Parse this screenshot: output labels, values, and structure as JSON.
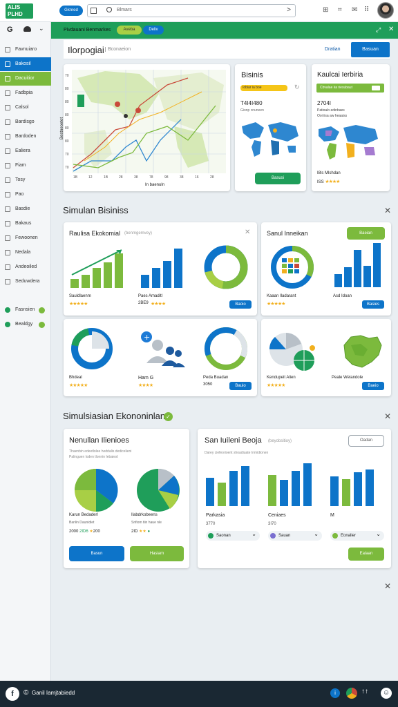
{
  "app": {
    "logo_text": "ALIS PLHD"
  },
  "topbar": {
    "btn_label": "Gknred",
    "search_placeholder": "Blmars"
  },
  "banner": {
    "title": "Pivdauani Benmarkes",
    "pill_green": "Aveba",
    "pill_blue": "Deliv"
  },
  "header": {
    "title": "Ilorpogiai",
    "subtitle": "Bconaeion",
    "link": "Dratian",
    "button": "Basuan"
  },
  "sidebar": {
    "top_icons": [
      "G",
      "cloud-icon"
    ],
    "items": [
      {
        "label": "Favnuiaro",
        "icon": "doc-icon"
      },
      {
        "label": "Bakosil",
        "icon": "doc-icon",
        "active": "blue"
      },
      {
        "label": "Dacuitior",
        "icon": "doc-icon",
        "active": "green"
      },
      {
        "label": "Fadbpia",
        "icon": "doc-icon"
      },
      {
        "label": "Calsol",
        "icon": "doc-icon"
      },
      {
        "label": "Bardisgo",
        "icon": "doc-icon"
      },
      {
        "label": "Bardoden",
        "icon": "doc-icon"
      },
      {
        "label": "Ealiera",
        "icon": "doc-icon"
      },
      {
        "label": "Fiam",
        "icon": "doc-icon"
      },
      {
        "label": "Tosy",
        "icon": "doc-icon"
      },
      {
        "label": "Pao",
        "icon": "doc-icon"
      },
      {
        "label": "Basdie",
        "icon": "doc-icon"
      },
      {
        "label": "Bakaus",
        "icon": "doc-icon"
      },
      {
        "label": "Fewoonen",
        "icon": "doc-icon"
      },
      {
        "label": "Nedala",
        "icon": "doc-icon"
      },
      {
        "label": "Andeoiled",
        "icon": "doc-icon"
      },
      {
        "label": "Seduwdera",
        "icon": "doc-icon"
      },
      {
        "label": "Fasnsien",
        "icon": "doc-icon"
      },
      {
        "label": "Bealdgy",
        "icon": "doc-icon"
      }
    ]
  },
  "dashboard": {
    "map_card": {
      "xlabel": "In baenuln",
      "ylabel": "Bestneoetot",
      "xticks": [
        "1B",
        "12",
        "1B",
        "28",
        "38",
        "78",
        "98",
        "38",
        "16",
        "28"
      ],
      "yticks": [
        "70",
        "80",
        "80",
        "80",
        "80",
        "80",
        "70",
        "70"
      ]
    },
    "card2": {
      "title": "Bisinis",
      "progress_label": "Iobiar ia boe",
      "value": "T4I4I480",
      "caption": "Gionp cnuneen",
      "button": "Basusi"
    },
    "card3": {
      "title": "Kaulcai Ierbiria",
      "progress_label": "Cbvalae ka riesubaut",
      "value": "2704I",
      "line1": "Patioalo edinbaes",
      "line2": "Ooi iisa aw heaaiss",
      "footer1": "I8ls Mlshdan",
      "footer2": "ISS"
    }
  },
  "section1": {
    "title": "Simulan Bisiniss",
    "card_a": {
      "title": "Raulisa Ekokomial",
      "subtitle": "(benmgemvey)",
      "chart_left": {
        "values": [
          14,
          20,
          30,
          38,
          52
        ]
      },
      "chart_mid": {
        "values": [
          18,
          28,
          38,
          55
        ]
      },
      "label1": "Sauldlaenm",
      "label2": "Paes Amaditl",
      "stars2": "2BE9",
      "button": "Baoio"
    },
    "card_b": {
      "title": "Sanul Inneikan",
      "button": "Baeian",
      "chart": {
        "values": [
          18,
          28,
          52,
          30,
          62
        ]
      },
      "label1": "Kaaan Iladarant",
      "label2": "Asd Idoan",
      "button2": "Basies"
    },
    "card_c": {
      "label1": "Bhdeal",
      "label2": "Ham G",
      "label3": "Peda Buadan",
      "stars3": "3050",
      "button": "Bauio"
    },
    "card_d": {
      "label1": "Kendupeit Alien",
      "label2": "Peale Welandole",
      "button": "Baeio"
    }
  },
  "section2": {
    "title": "Simulsiasian Ekononinlan",
    "card_a": {
      "title": "Nenullan Ilienioes",
      "desc1": "Thaenbin edeetlolee heddalis dedicelieni",
      "desc2": "Palinguen loden tlonnin Iebaiesl",
      "pie1": "Karun Bedaderl",
      "pie2": "Ilabdrkobeens",
      "sub1": "Banlin Daunidiet",
      "sub2": "Snfiom tiin haue nle",
      "val1": "2000",
      "val2": "2ID6",
      "val3": "200",
      "val4": "2ID",
      "btn_blue": "Basun",
      "btn_green": "Hasiam"
    },
    "card_b": {
      "title": "San Iuileni Beoja",
      "subtitle": "(beyobsitioy)",
      "desc": "Darey ciefeorioent shoadiuate Inmidionen",
      "button": "Oadan",
      "charts": [
        {
          "label": "Parkasia",
          "value": "3770",
          "chip": "Saonan",
          "values": [
            44,
            36,
            54,
            62
          ]
        },
        {
          "label": "Ceniaes",
          "value": "3I70",
          "chip": "Sauan",
          "values": [
            48,
            40,
            54,
            66
          ]
        },
        {
          "label": "M",
          "value": "",
          "chip": "Eonalier",
          "values": [
            46,
            42,
            52,
            56
          ]
        }
      ],
      "bottom_btn": "Ealaan"
    }
  },
  "taskbar": {
    "label": "Ganil Iamjtabiedd"
  },
  "colors": {
    "blue": "#0d74c9",
    "green": "#7cba3d",
    "dark_green": "#1f9e5a",
    "lime": "#a8cf45"
  }
}
